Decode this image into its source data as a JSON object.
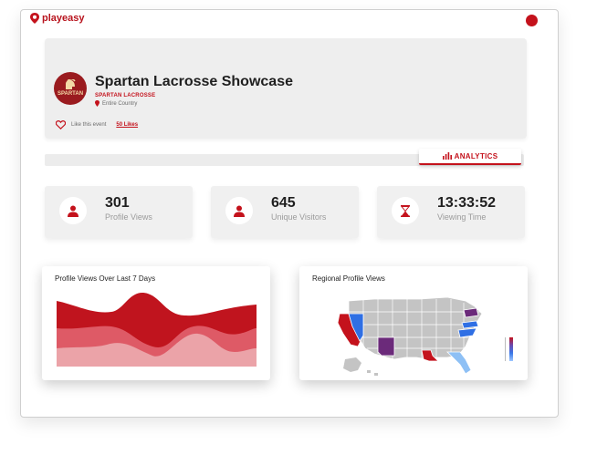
{
  "brand": {
    "name": "playeasy"
  },
  "event": {
    "title": "Spartan Lacrosse Showcase",
    "team": "SPARTAN LACROSSE",
    "location": "Entire Country",
    "like_label": "Like this event",
    "likes": "50 Likes",
    "logo_text": "SPARTAN"
  },
  "tab": {
    "label": "ANALYTICS"
  },
  "stats": [
    {
      "value": "301",
      "label": "Profile Views",
      "icon": "user-icon"
    },
    {
      "value": "645",
      "label": "Unique Visitors",
      "icon": "user-icon"
    },
    {
      "value": "13:33:52",
      "label": "Viewing Time",
      "icon": "hourglass-icon"
    }
  ],
  "charts": {
    "views": {
      "title": "Profile Views Over Last 7 Days"
    },
    "regional": {
      "title": "Regional Profile Views"
    }
  },
  "colors": {
    "accent": "#c4121c",
    "blue": "#2f6fe4",
    "purple": "#6b2a7a",
    "grey": "#c2c2c2"
  }
}
